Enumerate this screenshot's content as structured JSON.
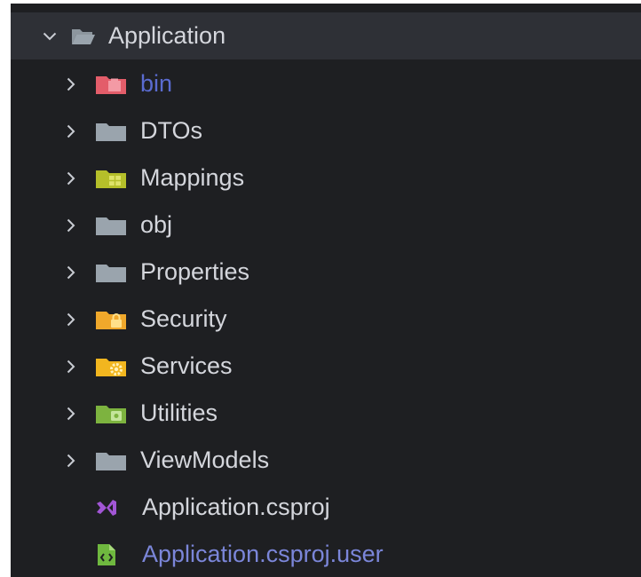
{
  "tree": {
    "root": {
      "label": "Application",
      "expanded": true,
      "icon": "folder-open-icon"
    },
    "items": [
      {
        "label": "bin",
        "type": "folder",
        "icon": "folder-bin-icon",
        "color": "#e35d6a",
        "muted": true
      },
      {
        "label": "DTOs",
        "type": "folder",
        "icon": "folder-icon",
        "color": "#9aa4ad"
      },
      {
        "label": "Mappings",
        "type": "folder",
        "icon": "folder-mappings-icon",
        "color": "#b5bf2a"
      },
      {
        "label": "obj",
        "type": "folder",
        "icon": "folder-icon",
        "color": "#9aa4ad"
      },
      {
        "label": "Properties",
        "type": "folder",
        "icon": "folder-icon",
        "color": "#9aa4ad"
      },
      {
        "label": "Security",
        "type": "folder",
        "icon": "folder-security-icon",
        "color": "#f0a82b"
      },
      {
        "label": "Services",
        "type": "folder",
        "icon": "folder-services-icon",
        "color": "#f2b61f"
      },
      {
        "label": "Utilities",
        "type": "folder",
        "icon": "folder-utilities-icon",
        "color": "#7db33f"
      },
      {
        "label": "ViewModels",
        "type": "folder",
        "icon": "folder-icon",
        "color": "#9aa4ad"
      },
      {
        "label": "Application.csproj",
        "type": "file",
        "icon": "visual-studio-icon",
        "color": "#a256d6"
      },
      {
        "label": "Application.csproj.user",
        "type": "file",
        "icon": "xml-file-icon",
        "color": "#6fb83f",
        "muted": true
      }
    ]
  }
}
